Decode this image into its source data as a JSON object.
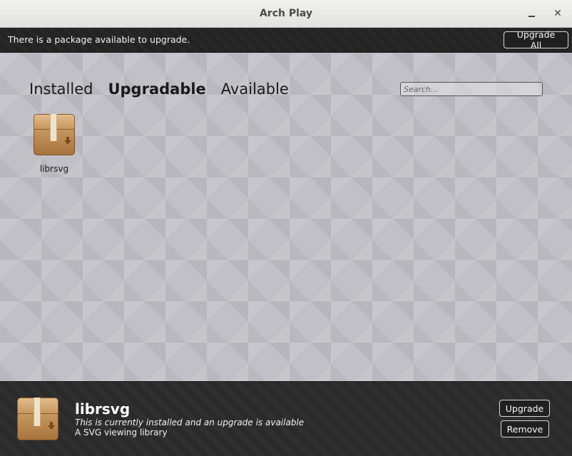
{
  "window": {
    "title": "Arch Play",
    "minimize_glyph": "minimize-icon",
    "close_glyph": "✕"
  },
  "notification": {
    "message": "There is a package available to upgrade.",
    "upgrade_all_label": "Upgrade All"
  },
  "tabs": [
    {
      "label": "Installed",
      "active": false
    },
    {
      "label": "Upgradable",
      "active": true
    },
    {
      "label": "Available",
      "active": false
    }
  ],
  "search": {
    "placeholder": "Search..."
  },
  "packages": [
    {
      "name": "librsvg",
      "icon": "package-box-icon"
    }
  ],
  "detail": {
    "name": "librsvg",
    "status": "This is currently installed and an upgrade is available",
    "description": "A SVG viewing library",
    "upgrade_label": "Upgrade",
    "remove_label": "Remove"
  },
  "colors": {
    "dark_bar": "#232323",
    "content_bg": "#c1c0c6",
    "box_brown": "#c99a63"
  }
}
